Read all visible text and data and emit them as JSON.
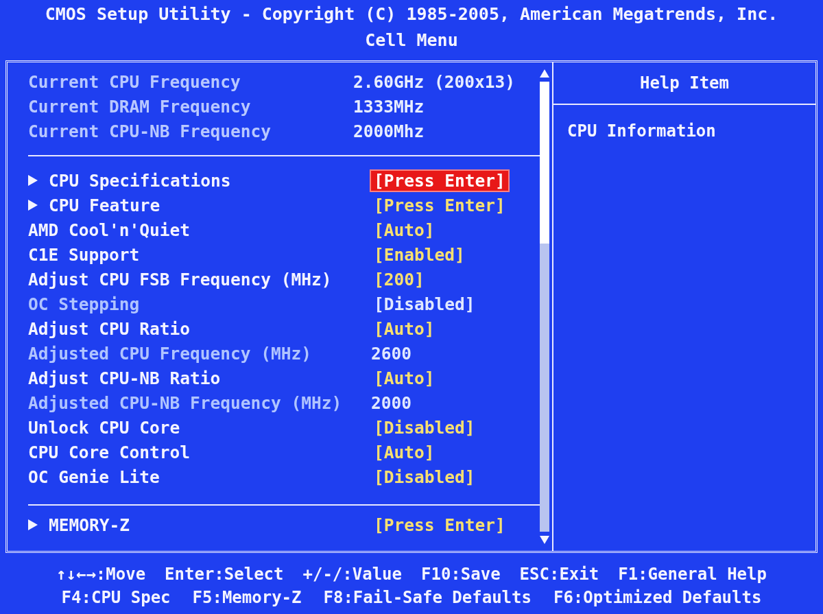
{
  "header": {
    "title": "CMOS Setup Utility - Copyright (C) 1985-2005, American Megatrends, Inc.",
    "subtitle": "Cell Menu"
  },
  "info": [
    {
      "label": "Current CPU Frequency",
      "value": "2.60GHz (200x13)"
    },
    {
      "label": "Current DRAM Frequency",
      "value": "1333MHz"
    },
    {
      "label": "Current CPU-NB Frequency",
      "value": "2000Mhz"
    }
  ],
  "items": [
    {
      "kind": "submenu",
      "label": "CPU Specifications",
      "value": "[Press Enter]",
      "selected": true,
      "disabled": false
    },
    {
      "kind": "submenu",
      "label": "CPU Feature",
      "value": "[Press Enter]",
      "selected": false,
      "disabled": false
    },
    {
      "kind": "setting",
      "label": "AMD Cool'n'Quiet",
      "value": "[Auto]",
      "selected": false,
      "disabled": false
    },
    {
      "kind": "setting",
      "label": "C1E Support",
      "value": "[Enabled]",
      "selected": false,
      "disabled": false
    },
    {
      "kind": "setting",
      "label": "Adjust CPU FSB Frequency (MHz)",
      "value": "[200]",
      "selected": false,
      "disabled": false
    },
    {
      "kind": "setting",
      "label": "OC Stepping",
      "value": "[Disabled]",
      "selected": false,
      "disabled": true
    },
    {
      "kind": "setting",
      "label": "Adjust CPU Ratio",
      "value": "[Auto]",
      "selected": false,
      "disabled": false
    },
    {
      "kind": "setting",
      "label": "Adjusted CPU Frequency (MHz)",
      "value": "2600",
      "selected": false,
      "disabled": true
    },
    {
      "kind": "setting",
      "label": "Adjust CPU-NB Ratio",
      "value": "[Auto]",
      "selected": false,
      "disabled": false
    },
    {
      "kind": "setting",
      "label": "Adjusted CPU-NB Frequency (MHz)",
      "value": "2000",
      "selected": false,
      "disabled": true
    },
    {
      "kind": "setting",
      "label": "Unlock CPU Core",
      "value": "[Disabled]",
      "selected": false,
      "disabled": false
    },
    {
      "kind": "setting",
      "label": "CPU Core Control",
      "value": "[Auto]",
      "selected": false,
      "disabled": false
    },
    {
      "kind": "setting",
      "label": "OC Genie Lite",
      "value": "[Disabled]",
      "selected": false,
      "disabled": false
    }
  ],
  "bottom_items": [
    {
      "kind": "submenu",
      "label": "MEMORY-Z",
      "value": "[Press Enter]",
      "selected": false,
      "disabled": false
    }
  ],
  "help": {
    "title": "Help Item",
    "text": "CPU Information"
  },
  "footer": [
    [
      "↑↓←→:Move",
      "Enter:Select",
      "+/-/:Value",
      "F10:Save",
      "ESC:Exit",
      "F1:General Help"
    ],
    [
      "F4:CPU Spec",
      "F5:Memory-Z",
      "F8:Fail-Safe Defaults",
      "F6:Optimized Defaults"
    ]
  ]
}
